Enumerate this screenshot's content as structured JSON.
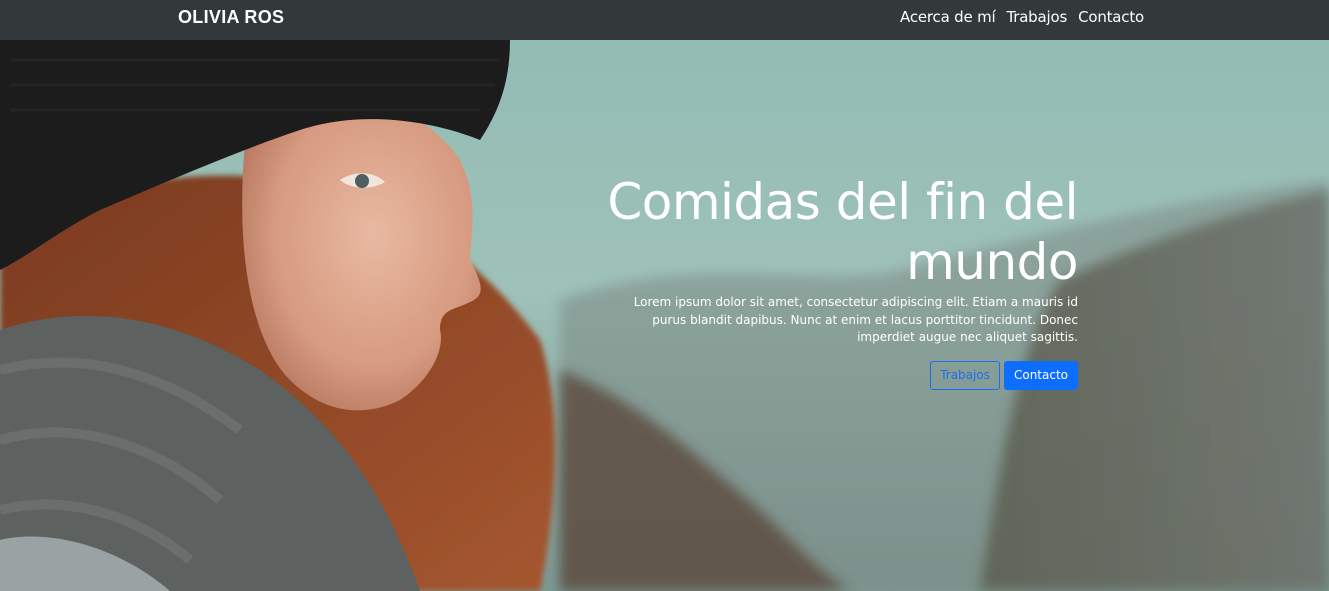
{
  "navbar": {
    "brand": "OLIVIA ROS",
    "links": [
      {
        "label": "Acerca de mí"
      },
      {
        "label": "Trabajos"
      },
      {
        "label": "Contacto"
      }
    ]
  },
  "hero": {
    "title": "Comidas del fin del mundo",
    "text": "Lorem ipsum dolor sit amet, consectetur adipiscing elit. Etiam a mauris id purus blandit dapibus. Nunc at enim et lacus porttitor tincidunt. Donec imperdiet augue nec aliquet sagittis.",
    "buttons": {
      "secondary_label": "Trabajos",
      "primary_label": "Contacto"
    },
    "image": "woman-portrait-photo"
  },
  "colors": {
    "navbar_bg": "#33383b",
    "primary": "#0d6efd",
    "text_light": "#ffffff"
  }
}
